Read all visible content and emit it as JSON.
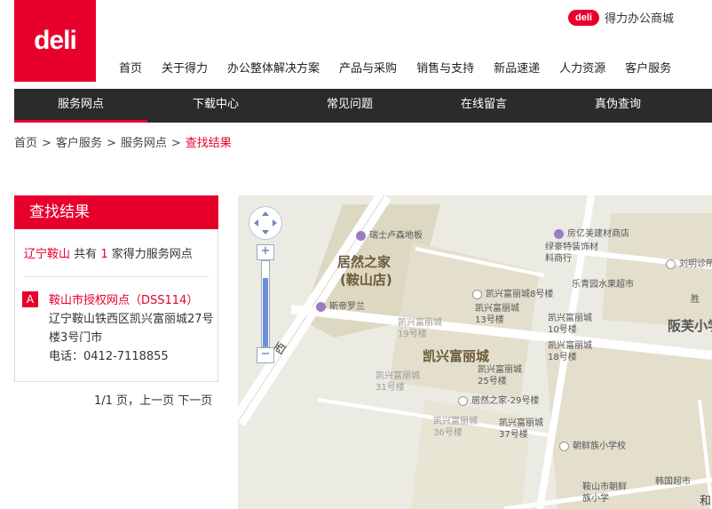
{
  "logo": {
    "text": "deli"
  },
  "mall": {
    "badge": "deli",
    "text": "得力办公商城"
  },
  "top_nav": [
    "首页",
    "关于得力",
    "办公整体解决方案",
    "产品与采购",
    "销售与支持",
    "新品速递",
    "人力资源",
    "客户服务"
  ],
  "sub_nav": [
    {
      "label": "服务网点",
      "active": true
    },
    {
      "label": "下载中心",
      "active": false
    },
    {
      "label": "常见问题",
      "active": false
    },
    {
      "label": "在线留言",
      "active": false
    },
    {
      "label": "真伪查询",
      "active": false
    }
  ],
  "breadcrumb": {
    "items": [
      "首页",
      "客户服务",
      "服务网点"
    ],
    "current": "查找结果",
    "separator": ">"
  },
  "result": {
    "title": "查找结果",
    "summary": {
      "region": "辽宁鞍山",
      "prefix": "共有",
      "count": "1",
      "suffix": "家得力服务网点"
    },
    "items": [
      {
        "marker": "A",
        "name": "鞍山市授权网点（DSS114）",
        "address": "辽宁鞍山铁西区凯兴富丽城27号楼3号门市",
        "phone": "电话：0412-7118855"
      }
    ],
    "pagination": {
      "info": "1/1 页，",
      "prev": "上一页",
      "next": "下一页"
    }
  },
  "map": {
    "labels": {
      "ruishi": "瑞士卢森地板",
      "furniture_mall": "居然之家",
      "furniture_mall_sub": "(鞍山店)",
      "sidi": "斯帝罗兰",
      "kx19": "凯兴富丽城19号楼",
      "kx_main": "凯兴富丽城",
      "kx31": "凯兴富丽城31号楼",
      "kx8": "凯兴富丽城8号楼",
      "kx13": "凯兴富丽城13号楼",
      "kx10": "凯兴富丽城10号楼",
      "kx18": "凯兴富丽城18号楼",
      "kx25": "凯兴富丽城25号楼",
      "jr29": "居然之家-29号楼",
      "kx36": "凯兴富丽城36号楼",
      "kx37": "凯兴富丽城37号楼",
      "fangyi": "房亿美建材商店",
      "luhao": "绿豪特装饰材料商行",
      "leqing": "乐青园水果超市",
      "liuming": "刘明诊所",
      "sheng": "胜",
      "banfu": "阪芙小学",
      "chaoxian": "朝鲜族小学校",
      "hanguo": "韩国超市",
      "anshan_cx": "鞍山市朝鲜族小学",
      "road_west": "西",
      "road_right": "和"
    },
    "zoom_level": 0.8
  },
  "colors": {
    "brand": "#e8002d",
    "nav_dark": "#2b2b2b"
  }
}
